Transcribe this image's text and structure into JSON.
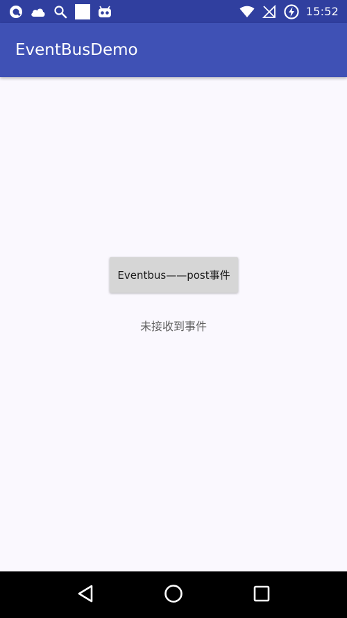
{
  "status_bar": {
    "time": "15:52",
    "left_icons": [
      "q-app-icon",
      "cloud-icon",
      "search-icon",
      "blank-notification-icon",
      "android-robot-icon"
    ],
    "right_icons": [
      "wifi-icon",
      "no-signal-icon",
      "battery-charging-icon"
    ]
  },
  "app_bar": {
    "title": "EventBusDemo",
    "color": "#3f51b5"
  },
  "main": {
    "post_button_label": "Eventbus——post事件",
    "result_text": "未接收到事件"
  },
  "navigation": {
    "items": [
      "back-icon",
      "home-icon",
      "recents-icon"
    ]
  },
  "colors": {
    "status_bar": "#303f9f",
    "primary": "#3f51b5",
    "background": "#faf8fe",
    "button": "#d6d6d6"
  }
}
